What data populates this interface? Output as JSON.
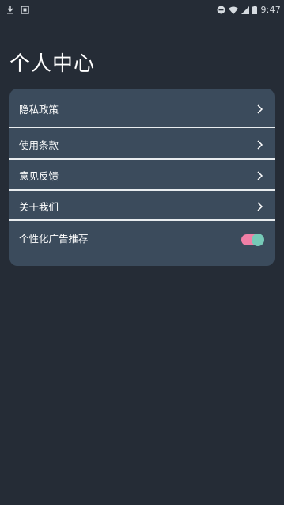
{
  "status_bar": {
    "time": "9:47",
    "left_icons": [
      "download-icon",
      "notification-box-icon"
    ],
    "right_icons": [
      "do-not-disturb-icon",
      "wifi-icon",
      "signal-icon",
      "battery-icon"
    ]
  },
  "page": {
    "title": "个人中心"
  },
  "menu": {
    "items": [
      {
        "label": "隐私政策",
        "icon": "chevron-right-icon"
      },
      {
        "label": "使用条款",
        "icon": "chevron-right-icon"
      },
      {
        "label": "意见反馈",
        "icon": "chevron-right-icon"
      },
      {
        "label": "关于我们",
        "icon": "chevron-right-icon"
      }
    ],
    "toggle_item": {
      "label": "个性化广告推荐",
      "on": true
    }
  },
  "colors": {
    "background": "#252c36",
    "card": "#3b4b5c",
    "toggle_track": "#f07fa6",
    "toggle_knob": "#76c9b7"
  }
}
